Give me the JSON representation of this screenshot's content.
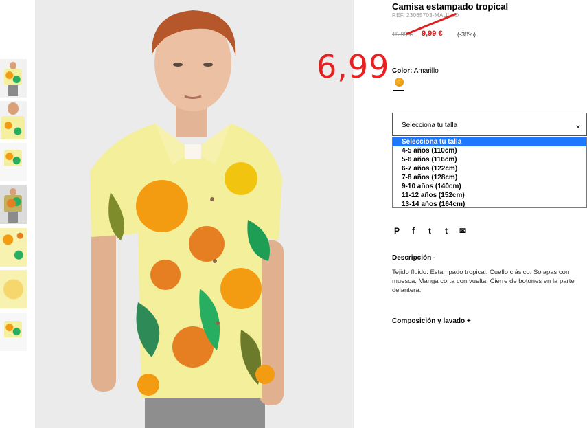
{
  "product": {
    "title": "Camisa estampado tropical",
    "ref": "REF. 23065703-MAUI-LO",
    "old_price": "15,99 €",
    "sale_price": "9,99 €",
    "discount": "(-38%)",
    "new_price_annotation": "6,99"
  },
  "color": {
    "label": "Color:",
    "value": "Amarillo",
    "swatch_color": "#f0a000"
  },
  "size": {
    "select_label": "Selecciona tu talla",
    "options": [
      "Selecciona tu talla",
      "4-5 años (110cm)",
      "5-6 años (116cm)",
      "6-7 años (122cm)",
      "7-8 años (128cm)",
      "9-10 años (140cm)",
      "11-12 años (152cm)",
      "13-14 años (164cm)"
    ]
  },
  "share": [
    "P",
    "f",
    "t",
    "t",
    "✉"
  ],
  "description": {
    "title": "Descripción -",
    "body": "Tejido fluido. Estampado tropical. Cuello clásico. Solapas con muesca. Manga corta con vuelta. Cierre de botones en la parte delantera."
  },
  "composition": {
    "title": "Composición y lavado +"
  },
  "colors": {
    "accent_red": "#e02020",
    "highlight_blue": "#1e78ff"
  }
}
